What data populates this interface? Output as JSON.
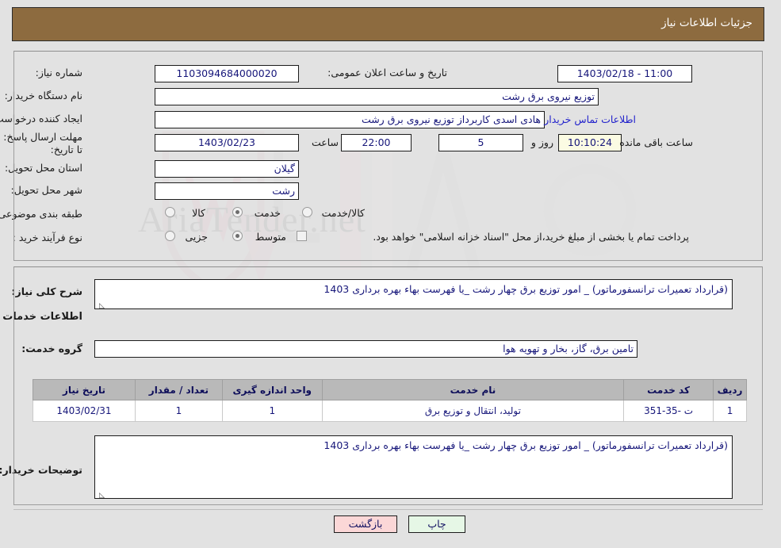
{
  "banner": {
    "title": "جزئیات اطلاعات نیاز"
  },
  "watermark": {
    "text": "AriaTender.net"
  },
  "form": {
    "need_number": {
      "label": "شماره نیاز:",
      "value": "1103094684000020"
    },
    "announce_datetime": {
      "label": "تاریخ و ساعت اعلان عمومی:",
      "value": "11:00 - 1403/02/18"
    },
    "buyer_org": {
      "label": "نام دستگاه خریدار:",
      "value": "توزیع نیروی برق رشت"
    },
    "request_creator": {
      "label": "ایجاد کننده درخواست:",
      "value": "هادی  اسدی کاربرداز توزیع نیروی برق رشت"
    },
    "buyer_contact_link": "اطلاعات تماس خریدار",
    "deadline": {
      "label": "مهلت ارسال پاسخ: تا تاریخ:",
      "date": "1403/02/23",
      "time_label": "ساعت",
      "time": "22:00",
      "days": "5",
      "days_label": "روز و",
      "countdown": "10:10:24",
      "countdown_label": "ساعت باقی مانده"
    },
    "delivery_province": {
      "label": "استان محل تحویل:",
      "value": "گیلان"
    },
    "delivery_city": {
      "label": "شهر محل تحویل:",
      "value": "رشت"
    },
    "subject_category": {
      "label": "طبقه بندی موضوعی:",
      "options": [
        "کالا",
        "خدمت",
        "کالا/خدمت"
      ],
      "selected": "خدمت"
    },
    "purchase_process": {
      "label": "نوع فرآیند خرید :",
      "options": [
        "جزیی",
        "متوسط"
      ],
      "selected": "متوسط"
    },
    "treasury_note": {
      "checked": false,
      "text": "پرداخت تمام یا بخشی از مبلغ خرید،از محل \"اسناد خزانه اسلامی\" خواهد بود."
    }
  },
  "need_summary": {
    "label": "شرح کلی نیاز:",
    "value": "(قرارداد تعمیرات ترانسفورماتور) _ امور توزیع برق چهار رشت _یا فهرست بهاء بهره برداری 1403"
  },
  "services_section": {
    "heading": "اطلاعات خدمات مورد نیاز",
    "service_group": {
      "label": "گروه خدمت:",
      "value": "تامین برق، گاز، بخار و تهویه هوا"
    }
  },
  "table": {
    "columns": [
      "ردیف",
      "کد خدمت",
      "نام خدمت",
      "واحد اندازه گیری",
      "تعداد / مقدار",
      "تاریخ نیاز"
    ],
    "rows": [
      {
        "row": "1",
        "service_code": "ت -35-351",
        "service_name": "تولید، انتقال و توزیع برق",
        "unit": "1",
        "quantity": "1",
        "need_date": "1403/02/31"
      }
    ]
  },
  "buyer_notes": {
    "label": "توضیحات خریدار:",
    "value": "(قرارداد تعمیرات ترانسفورماتور) _ امور توزیع برق چهار رشت _یا فهرست بهاء بهره برداری 1403"
  },
  "footer": {
    "print_label": "چاپ",
    "back_label": "بازگشت"
  },
  "colors": {
    "banner": "#8d6b3f",
    "page_bg": "#e2e2e2",
    "link": "#2222cc",
    "field_text": "#16167a",
    "table_header": "#b9b9b9",
    "print_button": "#e6f7e6",
    "back_button": "#fbd7d7",
    "countdown_field": "#fbfbe3"
  }
}
